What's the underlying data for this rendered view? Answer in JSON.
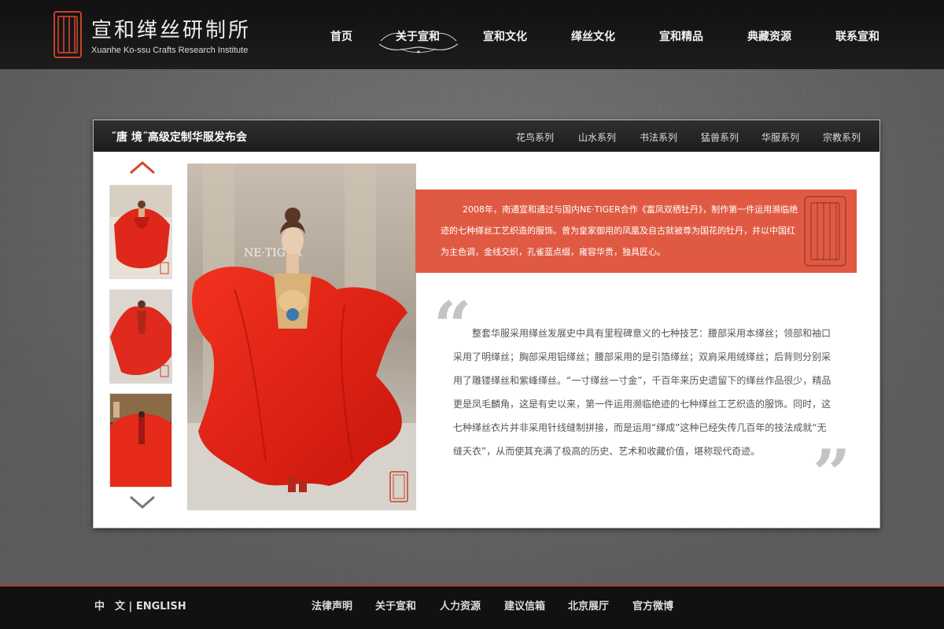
{
  "header": {
    "logo_cn": "宣和缂丝研制所",
    "logo_en": "Xuanhe Ko-ssu Crafts Research Institute",
    "nav": [
      "首页",
      "关于宣和",
      "宣和文化",
      "缂丝文化",
      "宣和精品",
      "典藏资源",
      "联系宣和"
    ],
    "active_nav": "关于宣和"
  },
  "panel": {
    "title": "˝唐  境˝高级定制华服发布会",
    "series": [
      "花鸟系列",
      "山水系列",
      "书法系列",
      "猛兽系列",
      "华服系列",
      "宗教系列"
    ],
    "intro": "2008年，南通宣和通过与国内NE·TIGER合作《富凤双栖牡丹》，制作第一件运用濒临绝迹的七种缂丝工艺织造的服饰。曾为皇家御用的凤凰及自古就被尊为国花的牡丹，并以中国红为主色调，金线交织，孔雀蓝点缀，雍容华贵，独具匠心。",
    "body": "整套华服采用缂丝发展史中具有里程碑意义的七种技艺：腰部采用本缂丝；领部和袖口采用了明缂丝；胸部采用铝缂丝；腰部采用的是引箔缂丝；双肩采用绒缂丝；后背则分别采用了雕镂缂丝和紫峰缂丝。“一寸缂丝一寸金”，千百年来历史遗留下的缂丝作品很少，精品更是凤毛麟角，这是有史以来，第一件运用濒临绝迹的七种缂丝工艺织造的服饰。同时，这七种缂丝衣片并非采用针线缝制拼接，而是运用“缂成”这种已经失传几百年的技法成就“无缝天衣”，从而使其充满了极高的历史、艺术和收藏价值，堪称现代奇迹。",
    "photo_brand": "NE·TIGER"
  },
  "footer": {
    "lang_cn": "中　文",
    "lang_sep": "|",
    "lang_en": "ENGLISH",
    "links": [
      "法律声明",
      "关于宣和",
      "人力资源",
      "建议信箱",
      "北京展厅",
      "官方微博"
    ]
  },
  "colors": {
    "accent_red": "#e05a43",
    "dark_bar": "#1d1d1d",
    "footer_line": "#b23a26"
  }
}
